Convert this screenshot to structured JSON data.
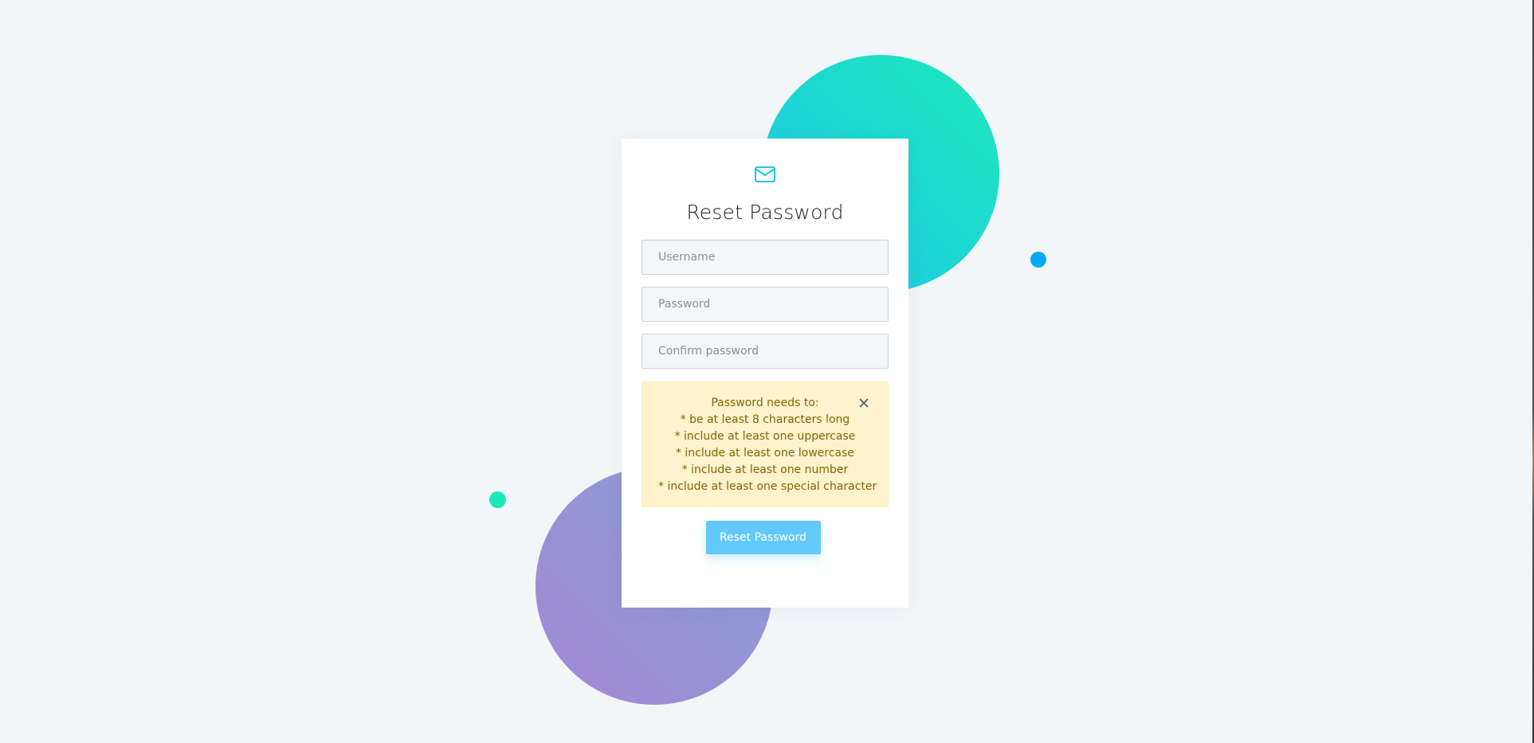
{
  "colors": {
    "background": "#f2f6f9",
    "accent": "#1dc4e9",
    "button": "#62c9fa",
    "alert_bg": "#fff3cd",
    "alert_text": "#856404"
  },
  "header": {
    "icon": "mail-icon",
    "title": "Reset Password"
  },
  "form": {
    "username": {
      "placeholder": "Username",
      "value": ""
    },
    "password": {
      "placeholder": "Password",
      "value": ""
    },
    "confirm_password": {
      "placeholder": "Confirm password",
      "value": ""
    }
  },
  "alert": {
    "heading": "Password needs to:",
    "rules": [
      "* be at least 8 characters long",
      "* include at least one uppercase",
      "* include at least one lowercase",
      "* include at least one number",
      "* include at least one special character"
    ],
    "close_icon": "close-icon"
  },
  "submit": {
    "label": "Reset Password"
  }
}
